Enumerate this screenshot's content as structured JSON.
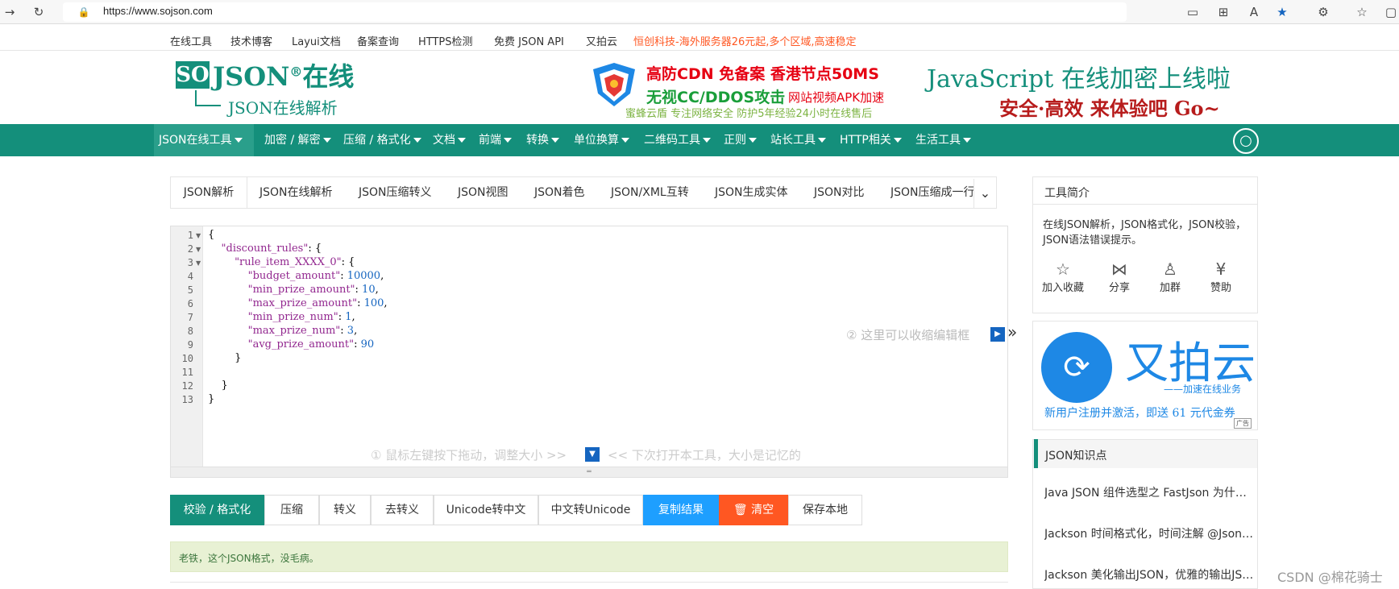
{
  "browser": {
    "url": "https://www.sojson.com"
  },
  "top_links": [
    "在线工具",
    "技术博客",
    "Layui文档",
    "备案查询",
    "HTTPS检测",
    "免费 JSON API",
    "又拍云",
    "恒创科技-海外服务器26元起,多个区域,高速稳定"
  ],
  "logo": {
    "so": "SO",
    "json": "JSON",
    "reg": "®",
    "online": "在线",
    "sub": "JSON在线解析"
  },
  "ad": {
    "line1": "高防CDN  免备案  香港节点50MS",
    "line2": "无视CC/DDOS攻击",
    "line2b": "网站视频APK加速",
    "line3": "蜜蜂云盾  专注网络安全  防护5年经验24小时在线售后",
    "line4": "JavaScript 在线加密上线啦",
    "line5": "安全·高效  来体验吧  Go~"
  },
  "nav": [
    "JSON在线工具",
    "加密 / 解密",
    "压缩 / 格式化",
    "文档",
    "前端",
    "转换",
    "单位换算",
    "二维码工具",
    "正则",
    "站长工具",
    "HTTP相关",
    "生活工具"
  ],
  "tabs": [
    "JSON解析",
    "JSON在线解析",
    "JSON压缩转义",
    "JSON视图",
    "JSON着色",
    "JSON/XML互转",
    "JSON生成实体",
    "JSON对比",
    "JSON压缩成一行"
  ],
  "editor": {
    "lines": [
      {
        "n": "1",
        "indent": "",
        "parts": [
          {
            "t": "{",
            "c": ""
          }
        ]
      },
      {
        "n": "2",
        "indent": "    ",
        "parts": [
          {
            "t": "\"discount_rules\"",
            "c": "k"
          },
          {
            "t": ": {",
            "c": ""
          }
        ]
      },
      {
        "n": "3",
        "indent": "        ",
        "parts": [
          {
            "t": "\"rule_item_XXXX_0\"",
            "c": "k"
          },
          {
            "t": ": {",
            "c": ""
          }
        ]
      },
      {
        "n": "4",
        "indent": "            ",
        "parts": [
          {
            "t": "\"budget_amount\"",
            "c": "k"
          },
          {
            "t": ": ",
            "c": ""
          },
          {
            "t": "10000",
            "c": "n"
          },
          {
            "t": ",",
            "c": ""
          }
        ]
      },
      {
        "n": "5",
        "indent": "            ",
        "parts": [
          {
            "t": "\"min_prize_amount\"",
            "c": "k"
          },
          {
            "t": ": ",
            "c": ""
          },
          {
            "t": "10",
            "c": "n"
          },
          {
            "t": ",",
            "c": ""
          }
        ]
      },
      {
        "n": "6",
        "indent": "            ",
        "parts": [
          {
            "t": "\"max_prize_amount\"",
            "c": "k"
          },
          {
            "t": ": ",
            "c": ""
          },
          {
            "t": "100",
            "c": "n"
          },
          {
            "t": ",",
            "c": ""
          }
        ]
      },
      {
        "n": "7",
        "indent": "            ",
        "parts": [
          {
            "t": "\"min_prize_num\"",
            "c": "k"
          },
          {
            "t": ": ",
            "c": ""
          },
          {
            "t": "1",
            "c": "n"
          },
          {
            "t": ",",
            "c": ""
          }
        ]
      },
      {
        "n": "8",
        "indent": "            ",
        "parts": [
          {
            "t": "\"max_prize_num\"",
            "c": "k"
          },
          {
            "t": ": ",
            "c": ""
          },
          {
            "t": "3",
            "c": "n"
          },
          {
            "t": ",",
            "c": ""
          }
        ]
      },
      {
        "n": "9",
        "indent": "            ",
        "parts": [
          {
            "t": "\"avg_prize_amount\"",
            "c": "k"
          },
          {
            "t": ": ",
            "c": ""
          },
          {
            "t": "90",
            "c": "n"
          }
        ]
      },
      {
        "n": "10",
        "indent": "        ",
        "parts": [
          {
            "t": "}",
            "c": ""
          }
        ]
      },
      {
        "n": "11",
        "indent": "",
        "parts": []
      },
      {
        "n": "12",
        "indent": "    ",
        "parts": [
          {
            "t": "}",
            "c": ""
          }
        ]
      },
      {
        "n": "13",
        "indent": "",
        "parts": [
          {
            "t": "}",
            "c": ""
          }
        ]
      }
    ],
    "hint_collapse": "② 这里可以收缩编辑框",
    "hint_drag": "① 鼠标左键按下拖动，调整大小 >>",
    "hint_remember": "<< 下次打开本工具，大小是记忆的"
  },
  "buttons": [
    "校验 / 格式化",
    "压缩",
    "转义",
    "去转义",
    "Unicode转中文",
    "中文转Unicode",
    "复制结果",
    "清空",
    "保存本地"
  ],
  "result": "老铁，这个JSON格式，没毛病。",
  "sidebar": {
    "intro_title": "工具简介",
    "intro_text": "在线JSON解析，JSON格式化，JSON校验，JSON语法错误提示。",
    "actions": [
      "加入收藏",
      "分享",
      "加群",
      "赞助"
    ],
    "upyun": {
      "name": "又拍云",
      "tag": "——加速在线业务",
      "promo": "新用户注册并激活，即送 61 元代金券",
      "badge": "广告"
    },
    "kb_title": "JSON知识点",
    "kb_items": [
      "Java JSON 组件选型之 FastJson 为什么...",
      "Jackson 时间格式化，时间注解 @JsonFormat...",
      "Jackson 美化输出JSON，优雅的输出JSON..."
    ]
  },
  "watermark": "CSDN @棉花骑士",
  "colors": {
    "brand": "#148f7b",
    "blue": "#1e9fff",
    "orange": "#ff5722"
  }
}
